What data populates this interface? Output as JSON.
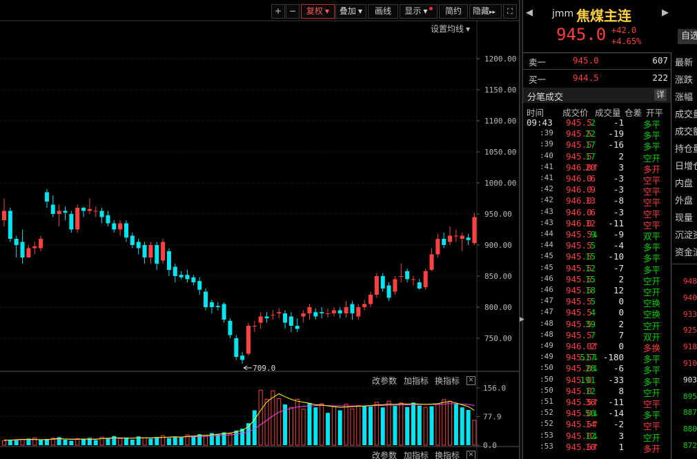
{
  "toolbar": {
    "zoom_in": "+",
    "zoom_out": "−",
    "fuquan": "复权",
    "overlay": "叠加",
    "draw": "画线",
    "display": "显示",
    "simple": "简约",
    "hide": "隐藏",
    "hide_arrows": "▸▸",
    "fullscreen": "⛶"
  },
  "main_chart": {
    "ma_settings": "设置均线",
    "y_ticks": [
      "1200.00",
      "1150.00",
      "1100.00",
      "1050.00",
      "1000.00",
      "950.00",
      "900.00",
      "850.00",
      "800.00",
      "750.00"
    ],
    "low_marker": "709.0"
  },
  "volume_panel": {
    "change_params": "改参数",
    "add_indicator": "加指标",
    "switch_indicator": "换指标",
    "close": "×",
    "y_ticks": [
      "156.0",
      "77.9",
      "0.0"
    ]
  },
  "bottom_panel": {
    "change_params": "改参数",
    "add_indicator": "加指标",
    "switch_indicator": "换指标",
    "close": "×"
  },
  "header": {
    "code": "jmm",
    "name": "焦煤主连",
    "price": "945.0",
    "change": "+42.0",
    "change_pct": "+4.65%",
    "watchlist": "自选",
    "prev_arrow": "◀",
    "next_arrow": "▶"
  },
  "orderbook": [
    {
      "label": "卖一",
      "price": "945.0",
      "volume": "607"
    },
    {
      "label": "买一",
      "price": "944.5",
      "volume": "222"
    }
  ],
  "ticks": {
    "title": "分笔成交",
    "detail": "详",
    "headers": [
      "时间",
      "成交价",
      "成交量",
      "仓差",
      "开平"
    ],
    "rows": [
      {
        "time": "09:43",
        "price": "945.5",
        "arrow": "",
        "vol": "2",
        "oi": "-1",
        "type": "多平",
        "pc": "red",
        "tc": "green"
      },
      {
        "time": ":39",
        "price": "945.5",
        "arrow": "",
        "vol": "22",
        "oi": "-19",
        "type": "多平",
        "pc": "red",
        "tc": "green"
      },
      {
        "time": ":39",
        "price": "945.5",
        "arrow": "",
        "vol": "17",
        "oi": "-16",
        "type": "多平",
        "pc": "red",
        "tc": "green"
      },
      {
        "time": ":40",
        "price": "945.5",
        "arrow": "",
        "vol": "17",
        "oi": "2",
        "type": "空开",
        "pc": "red",
        "tc": "green"
      },
      {
        "time": ":41",
        "price": "946.0",
        "arrow": "↑",
        "vol": "20",
        "oi": "3",
        "type": "多开",
        "pc": "red",
        "tc": "red"
      },
      {
        "time": ":41",
        "price": "946.0",
        "arrow": "",
        "vol": "6",
        "oi": "-3",
        "type": "空平",
        "pc": "red",
        "tc": "red"
      },
      {
        "time": ":42",
        "price": "946.0",
        "arrow": "",
        "vol": "9",
        "oi": "-3",
        "type": "空平",
        "pc": "red",
        "tc": "red"
      },
      {
        "time": ":42",
        "price": "946.0",
        "arrow": "",
        "vol": "13",
        "oi": "-8",
        "type": "空平",
        "pc": "red",
        "tc": "red"
      },
      {
        "time": ":43",
        "price": "946.0",
        "arrow": "",
        "vol": "6",
        "oi": "-3",
        "type": "空平",
        "pc": "red",
        "tc": "red"
      },
      {
        "time": ":43",
        "price": "946.0",
        "arrow": "",
        "vol": "12",
        "oi": "-11",
        "type": "空平",
        "pc": "red",
        "tc": "red"
      },
      {
        "time": ":44",
        "price": "945.5",
        "arrow": "↓",
        "vol": "9",
        "oi": "-9",
        "type": "双平",
        "pc": "red",
        "tc": "green"
      },
      {
        "time": ":44",
        "price": "945.5",
        "arrow": "",
        "vol": "5",
        "oi": "-4",
        "type": "多平",
        "pc": "red",
        "tc": "green"
      },
      {
        "time": ":45",
        "price": "945.5",
        "arrow": "",
        "vol": "15",
        "oi": "-10",
        "type": "多平",
        "pc": "red",
        "tc": "green"
      },
      {
        "time": ":45",
        "price": "945.5",
        "arrow": "",
        "vol": "12",
        "oi": "-7",
        "type": "多平",
        "pc": "red",
        "tc": "green"
      },
      {
        "time": ":46",
        "price": "945.5",
        "arrow": "",
        "vol": "15",
        "oi": "2",
        "type": "空开",
        "pc": "red",
        "tc": "green"
      },
      {
        "time": ":46",
        "price": "945.5",
        "arrow": "",
        "vol": "18",
        "oi": "12",
        "type": "空开",
        "pc": "red",
        "tc": "green"
      },
      {
        "time": ":47",
        "price": "945.5",
        "arrow": "",
        "vol": "5",
        "oi": "0",
        "type": "空换",
        "pc": "red",
        "tc": "green"
      },
      {
        "time": ":47",
        "price": "945.5",
        "arrow": "",
        "vol": "4",
        "oi": "0",
        "type": "空换",
        "pc": "red",
        "tc": "green"
      },
      {
        "time": ":48",
        "price": "945.5",
        "arrow": "",
        "vol": "39",
        "oi": "2",
        "type": "空开",
        "pc": "red",
        "tc": "green"
      },
      {
        "time": ":48",
        "price": "945.5",
        "arrow": "",
        "vol": "7",
        "oi": "7",
        "type": "双开",
        "pc": "red",
        "tc": "green"
      },
      {
        "time": ":49",
        "price": "946.0",
        "arrow": "↑",
        "vol": "2",
        "oi": "0",
        "type": "多换",
        "pc": "red",
        "tc": "red"
      },
      {
        "time": ":49",
        "price": "945.5",
        "arrow": "↓",
        "vol": "517",
        "oi": "-180",
        "type": "多平",
        "pc": "red",
        "tc": "green"
      },
      {
        "time": ":50",
        "price": "945.0",
        "arrow": "↓",
        "vol": "28",
        "oi": "-6",
        "type": "多平",
        "pc": "red",
        "tc": "green"
      },
      {
        "time": ":50",
        "price": "945.0",
        "arrow": "",
        "vol": "191",
        "oi": "-33",
        "type": "多平",
        "pc": "red",
        "tc": "green"
      },
      {
        "time": ":50",
        "price": "945.0",
        "arrow": "",
        "vol": "12",
        "oi": "8",
        "type": "空开",
        "pc": "red",
        "tc": "green"
      },
      {
        "time": ":51",
        "price": "945.5",
        "arrow": "↑",
        "vol": "36",
        "oi": "-11",
        "type": "空平",
        "pc": "red",
        "tc": "red"
      },
      {
        "time": ":52",
        "price": "945.0",
        "arrow": "↓",
        "vol": "50",
        "oi": "-14",
        "type": "多平",
        "pc": "red",
        "tc": "green"
      },
      {
        "time": ":52",
        "price": "945.5",
        "arrow": "↑",
        "vol": "14",
        "oi": "-2",
        "type": "空平",
        "pc": "red",
        "tc": "red"
      },
      {
        "time": ":53",
        "price": "945.0",
        "arrow": "↓",
        "vol": "12",
        "oi": "3",
        "type": "空开",
        "pc": "red",
        "tc": "green"
      },
      {
        "time": ":53",
        "price": "945.5",
        "arrow": "↑",
        "vol": "10",
        "oi": "1",
        "type": "多开",
        "pc": "red",
        "tc": "red"
      }
    ]
  },
  "side_labels": [
    "最新",
    "涨跌",
    "涨幅",
    "成交量",
    "成交额",
    "持仓量",
    "日增仓",
    "内盘",
    "外盘",
    "现量",
    "沉淀资金",
    "资金流"
  ],
  "side_prices": [
    {
      "v": "948",
      "c": "red"
    },
    {
      "v": "940",
      "c": "red"
    },
    {
      "v": "933",
      "c": "red"
    },
    {
      "v": "925",
      "c": "red"
    },
    {
      "v": "918",
      "c": "red"
    },
    {
      "v": "910",
      "c": "red"
    },
    {
      "v": "903",
      "c": "white"
    },
    {
      "v": "895",
      "c": "green"
    },
    {
      "v": "887",
      "c": "green"
    },
    {
      "v": "880",
      "c": "green"
    },
    {
      "v": "872",
      "c": "green"
    }
  ],
  "colors": {
    "up": "#ff4040",
    "down": "#00e5f0",
    "grid": "#3a3a3a",
    "ma1": "#ffff00",
    "ma2": "#ff40ff"
  },
  "chart_data": {
    "type": "candlestick",
    "y_axis_ticks": [
      1200,
      1150,
      1100,
      1050,
      1000,
      950,
      900,
      850,
      800,
      750
    ],
    "low_annotation": 709.0,
    "candles": [
      [
        940,
        955,
        975,
        930
      ],
      [
        955,
        910,
        960,
        905
      ],
      [
        910,
        900,
        915,
        880
      ],
      [
        905,
        880,
        925,
        870
      ],
      [
        880,
        895,
        900,
        880
      ],
      [
        895,
        898,
        905,
        885
      ],
      [
        895,
        910,
        915,
        890
      ],
      [
        985,
        970,
        990,
        960
      ],
      [
        965,
        950,
        980,
        945
      ],
      [
        950,
        955,
        965,
        930
      ],
      [
        955,
        952,
        962,
        940
      ],
      [
        950,
        925,
        955,
        920
      ],
      [
        925,
        960,
        965,
        920
      ],
      [
        960,
        955,
        962,
        945
      ],
      [
        955,
        958,
        975,
        950
      ],
      [
        955,
        955,
        962,
        945
      ],
      [
        955,
        945,
        960,
        935
      ],
      [
        948,
        935,
        955,
        930
      ],
      [
        935,
        925,
        940,
        920
      ],
      [
        925,
        935,
        940,
        915
      ],
      [
        935,
        912,
        940,
        905
      ],
      [
        915,
        900,
        920,
        895
      ],
      [
        905,
        895,
        910,
        885
      ],
      [
        900,
        880,
        905,
        870
      ],
      [
        880,
        900,
        905,
        870
      ],
      [
        900,
        870,
        905,
        860
      ],
      [
        875,
        905,
        910,
        870
      ],
      [
        890,
        860,
        895,
        850
      ],
      [
        865,
        850,
        870,
        840
      ],
      [
        852,
        848,
        858,
        845
      ],
      [
        852,
        845,
        860,
        840
      ],
      [
        848,
        840,
        852,
        835
      ],
      [
        842,
        828,
        848,
        820
      ],
      [
        825,
        800,
        830,
        795
      ],
      [
        808,
        800,
        812,
        790
      ],
      [
        802,
        800,
        808,
        795
      ],
      [
        805,
        780,
        808,
        775
      ],
      [
        778,
        755,
        782,
        750
      ],
      [
        750,
        720,
        755,
        715
      ],
      [
        722,
        715,
        728,
        709
      ],
      [
        725,
        770,
        775,
        722
      ],
      [
        770,
        770,
        778,
        760
      ],
      [
        775,
        785,
        792,
        765
      ],
      [
        785,
        782,
        792,
        775
      ],
      [
        788,
        788,
        795,
        780
      ],
      [
        790,
        792,
        798,
        782
      ],
      [
        790,
        775,
        795,
        765
      ],
      [
        785,
        770,
        792,
        760
      ],
      [
        770,
        765,
        782,
        760
      ],
      [
        785,
        790,
        795,
        775
      ],
      [
        790,
        800,
        805,
        780
      ],
      [
        792,
        785,
        798,
        780
      ],
      [
        792,
        790,
        800,
        782
      ],
      [
        790,
        790,
        798,
        783
      ],
      [
        790,
        795,
        800,
        785
      ],
      [
        795,
        790,
        800,
        782
      ],
      [
        790,
        800,
        810,
        783
      ],
      [
        805,
        790,
        810,
        780
      ],
      [
        785,
        800,
        805,
        780
      ],
      [
        800,
        805,
        812,
        795
      ],
      [
        805,
        820,
        825,
        800
      ],
      [
        820,
        850,
        855,
        815
      ],
      [
        850,
        830,
        855,
        825
      ],
      [
        835,
        815,
        840,
        810
      ],
      [
        825,
        845,
        850,
        820
      ],
      [
        850,
        850,
        870,
        840
      ],
      [
        858,
        845,
        862,
        840
      ],
      [
        845,
        845,
        850,
        835
      ],
      [
        840,
        830,
        845,
        828
      ],
      [
        832,
        858,
        862,
        828
      ],
      [
        860,
        885,
        895,
        858
      ],
      [
        885,
        910,
        918,
        880
      ],
      [
        910,
        900,
        920,
        895
      ],
      [
        905,
        915,
        930,
        900
      ],
      [
        915,
        915,
        925,
        905
      ],
      [
        910,
        915,
        920,
        890
      ],
      [
        912,
        908,
        918,
        900
      ],
      [
        903,
        945,
        952,
        900
      ]
    ],
    "volume_y_ticks": [
      156.0,
      77.9,
      0.0
    ],
    "volumes": [
      [
        12,
        0
      ],
      [
        15,
        1
      ],
      [
        13,
        1
      ],
      [
        16,
        0
      ],
      [
        18,
        1
      ],
      [
        20,
        0
      ],
      [
        14,
        1
      ],
      [
        17,
        1
      ],
      [
        19,
        0
      ],
      [
        22,
        1
      ],
      [
        15,
        1
      ],
      [
        12,
        1
      ],
      [
        18,
        0
      ],
      [
        16,
        1
      ],
      [
        20,
        1
      ],
      [
        14,
        1
      ],
      [
        22,
        0
      ],
      [
        19,
        1
      ],
      [
        25,
        1
      ],
      [
        18,
        0
      ],
      [
        21,
        1
      ],
      [
        15,
        1
      ],
      [
        24,
        1
      ],
      [
        20,
        0
      ],
      [
        18,
        1
      ],
      [
        22,
        1
      ],
      [
        26,
        0
      ],
      [
        19,
        1
      ],
      [
        23,
        1
      ],
      [
        21,
        1
      ],
      [
        28,
        0
      ],
      [
        25,
        1
      ],
      [
        30,
        1
      ],
      [
        27,
        0
      ],
      [
        33,
        1
      ],
      [
        29,
        1
      ],
      [
        35,
        1
      ],
      [
        31,
        0
      ],
      [
        40,
        1
      ],
      [
        45,
        1
      ],
      [
        60,
        1
      ],
      [
        95,
        1
      ],
      [
        150,
        0
      ],
      [
        125,
        0
      ],
      [
        148,
        0
      ],
      [
        127,
        0
      ],
      [
        111,
        1
      ],
      [
        103,
        0
      ],
      [
        125,
        0
      ],
      [
        98,
        0
      ],
      [
        115,
        1
      ],
      [
        103,
        1
      ],
      [
        113,
        0
      ],
      [
        88,
        1
      ],
      [
        105,
        0
      ],
      [
        95,
        1
      ],
      [
        112,
        0
      ],
      [
        99,
        0
      ],
      [
        108,
        0
      ],
      [
        107,
        1
      ],
      [
        105,
        1
      ],
      [
        117,
        0
      ],
      [
        103,
        1
      ],
      [
        120,
        0
      ],
      [
        107,
        1
      ],
      [
        115,
        0
      ],
      [
        104,
        1
      ],
      [
        116,
        1
      ],
      [
        108,
        1
      ],
      [
        103,
        0
      ],
      [
        106,
        1
      ],
      [
        112,
        0
      ],
      [
        124,
        0
      ],
      [
        120,
        0
      ],
      [
        112,
        1
      ],
      [
        103,
        1
      ],
      [
        96,
        1
      ],
      [
        68,
        0
      ]
    ],
    "ma_short": [
      14,
      14,
      15,
      16,
      16,
      16,
      15,
      15,
      17,
      18,
      17,
      16,
      16,
      17,
      16,
      16,
      18,
      19,
      20,
      20,
      19,
      19,
      20,
      20,
      20,
      21,
      21,
      22,
      23,
      22,
      24,
      25,
      26,
      27,
      28,
      30,
      31,
      33,
      36,
      41,
      50,
      70,
      95,
      118,
      130,
      140,
      132,
      125,
      120,
      117,
      114,
      110,
      110,
      107,
      105,
      103,
      104,
      105,
      106,
      107,
      108,
      110,
      110,
      112,
      111,
      113,
      112,
      113,
      112,
      111,
      112,
      113,
      117,
      119,
      115,
      110,
      105,
      95
    ],
    "ma_long": [
      14,
      14,
      14,
      15,
      15,
      15,
      15,
      16,
      16,
      17,
      17,
      17,
      17,
      17,
      17,
      17,
      18,
      18,
      19,
      19,
      19,
      19,
      20,
      20,
      20,
      20,
      21,
      21,
      22,
      22,
      23,
      23,
      24,
      24,
      25,
      26,
      27,
      28,
      30,
      32,
      36,
      44,
      56,
      68,
      80,
      90,
      96,
      100,
      104,
      106,
      107,
      108,
      108,
      108,
      107,
      107,
      107,
      107,
      107,
      107,
      107,
      108,
      108,
      109,
      109,
      110,
      110,
      110,
      111,
      111,
      111,
      111,
      112,
      113,
      113,
      112,
      111,
      108
    ]
  }
}
